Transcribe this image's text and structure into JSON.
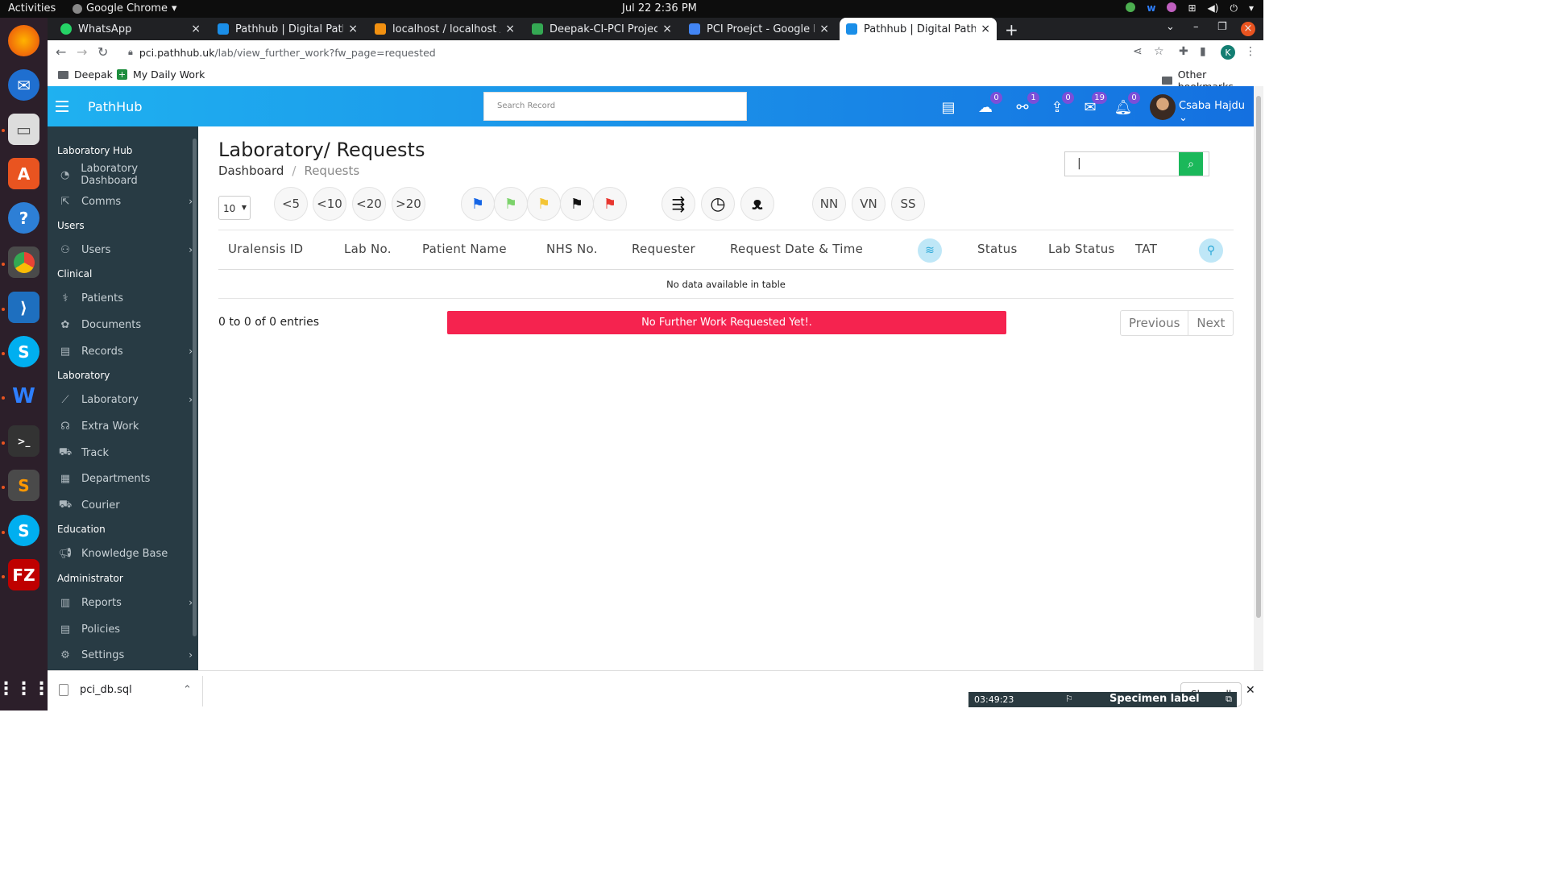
{
  "system": {
    "activities": "Activities",
    "app_name": "Google Chrome",
    "clock": "Jul 22  2:36 PM"
  },
  "browser": {
    "tabs": [
      {
        "title": "WhatsApp",
        "color": "#25d366"
      },
      {
        "title": "Pathhub | Digital Patholo",
        "color": "#1a8ee8"
      },
      {
        "title": "localhost / localhost / pci_",
        "color": "#f29111"
      },
      {
        "title": "Deepak-CI-PCI Project - Go",
        "color": "#34a853"
      },
      {
        "title": "PCI Proejct - Google Docs",
        "color": "#4285f4"
      },
      {
        "title": "Pathhub | Digital Patholo",
        "color": "#1a8ee8"
      }
    ],
    "active_tab_index": 5,
    "url_domain": "pci.pathhub.uk",
    "url_path": "/lab/view_further_work?fw_page=requested",
    "profile_initial": "K",
    "bookmarks": [
      {
        "label": "Deepak"
      },
      {
        "label": "My Daily Work"
      }
    ],
    "other_bookmarks": "Other bookmarks"
  },
  "header": {
    "brand": "PathHub",
    "search_placeholder": "Search Record",
    "badges": {
      "upload": "0",
      "link": "1",
      "share": "0",
      "mail": "19",
      "bell": "0"
    },
    "user_name": "Csaba Hajdu"
  },
  "sidebar": {
    "sections": {
      "laboratory_hub": "Laboratory Hub",
      "users": "Users",
      "clinical": "Clinical",
      "laboratory": "Laboratory",
      "education": "Education",
      "administrator": "Administrator"
    },
    "items": {
      "lab_dashboard": "Laboratory Dashboard",
      "comms": "Comms",
      "users": "Users",
      "patients": "Patients",
      "documents": "Documents",
      "records": "Records",
      "laboratory": "Laboratory",
      "extra_work": "Extra Work",
      "track": "Track",
      "departments": "Departments",
      "courier": "Courier",
      "knowledge_base": "Knowledge Base",
      "reports": "Reports",
      "policies": "Policies",
      "settings": "Settings"
    }
  },
  "main": {
    "title": "Laboratory/ Requests",
    "breadcrumb": {
      "home": "Dashboard",
      "current": "Requests"
    },
    "page_size": "10",
    "tat_filters": [
      "<5",
      "<10",
      "<20",
      ">20"
    ],
    "flags": [
      {
        "name": "blue-flag",
        "color": "#1565e6"
      },
      {
        "name": "green-flag",
        "color": "#7cd36b"
      },
      {
        "name": "yellow-flag",
        "color": "#f4c534"
      },
      {
        "name": "black-flag",
        "color": "#111111"
      },
      {
        "name": "red-flag",
        "color": "#e8362f"
      }
    ],
    "text_filters": [
      "NN",
      "VN",
      "SS"
    ],
    "columns": {
      "uralensis_id": "Uralensis ID",
      "lab_no": "Lab No.",
      "patient_name": "Patient Name",
      "nhs_no": "NHS No.",
      "requester": "Requester",
      "request_date": "Request Date & Time",
      "status": "Status",
      "lab_status": "Lab Status",
      "tat": "TAT"
    },
    "empty_message": "No data available in table",
    "entries_info": "0 to 0 of 0 entries",
    "alert": "No Further Work Requested Yet!.",
    "pager": {
      "previous": "Previous",
      "next": "Next"
    }
  },
  "downloads": {
    "file": "pci_db.sql",
    "show_all": "Show all"
  },
  "specimen": {
    "time": "03:49:23",
    "label": "Specimen label"
  }
}
